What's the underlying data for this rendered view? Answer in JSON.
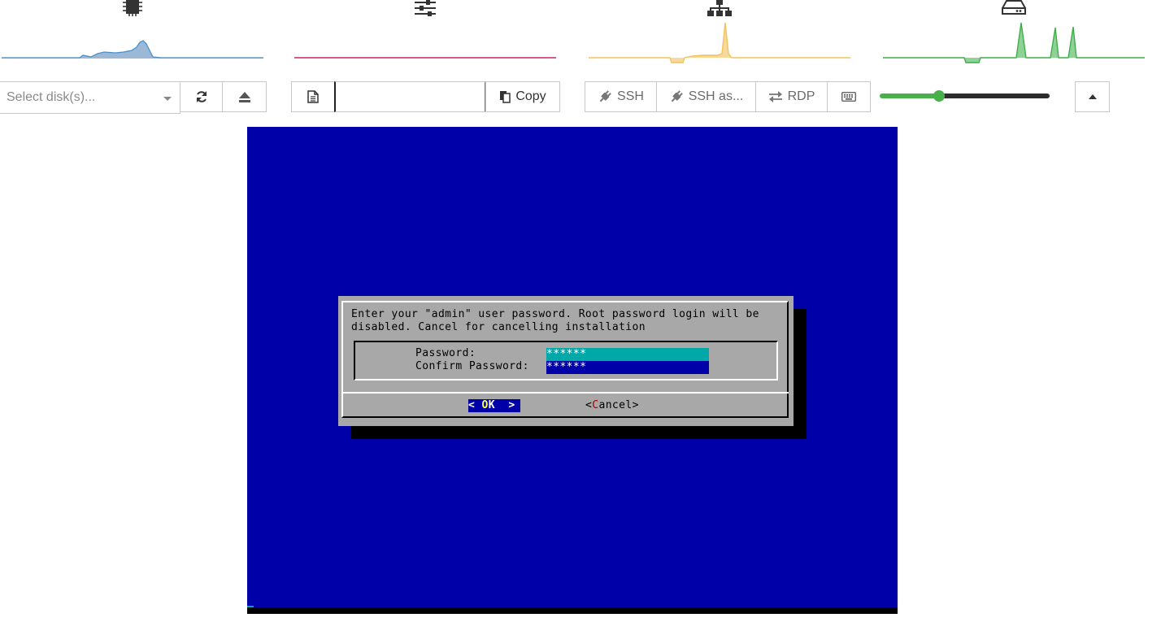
{
  "graphs": [
    {
      "name": "cpu",
      "icon": "cpu-chip-icon",
      "color": "#4a90c8",
      "fill": "#9bb9d6"
    },
    {
      "name": "memory",
      "icon": "sliders-icon",
      "color": "#c8256e",
      "fill": "#e7a1c1"
    },
    {
      "name": "network",
      "icon": "network-icon",
      "color": "#f2c35a",
      "fill": "#f7d99c"
    },
    {
      "name": "disk",
      "icon": "disk-drive-icon",
      "color": "#3fae49",
      "fill": "#8fd196"
    }
  ],
  "toolbar": {
    "disk_select_placeholder": "Select disk(s)...",
    "copy_label": "Copy",
    "ssh_label": "SSH",
    "ssh_as_label": "SSH as...",
    "rdp_label": "RDP",
    "slider_value_fraction": 0.35
  },
  "console": {
    "background": "#0000a8",
    "dialog": {
      "message_line1": "Enter your \"admin\" user password. Root password login will be",
      "message_line2": "disabled. Cancel for cancelling installation",
      "password_label": "Password:",
      "password_value": "******",
      "confirm_label": "Confirm Password:",
      "confirm_value": "******",
      "ok_open": "< ",
      "ok_hot": "O",
      "ok_rest": "K",
      "ok_close": "  >",
      "cancel_open": "<",
      "cancel_hot": "C",
      "cancel_rest": "ancel>"
    }
  }
}
